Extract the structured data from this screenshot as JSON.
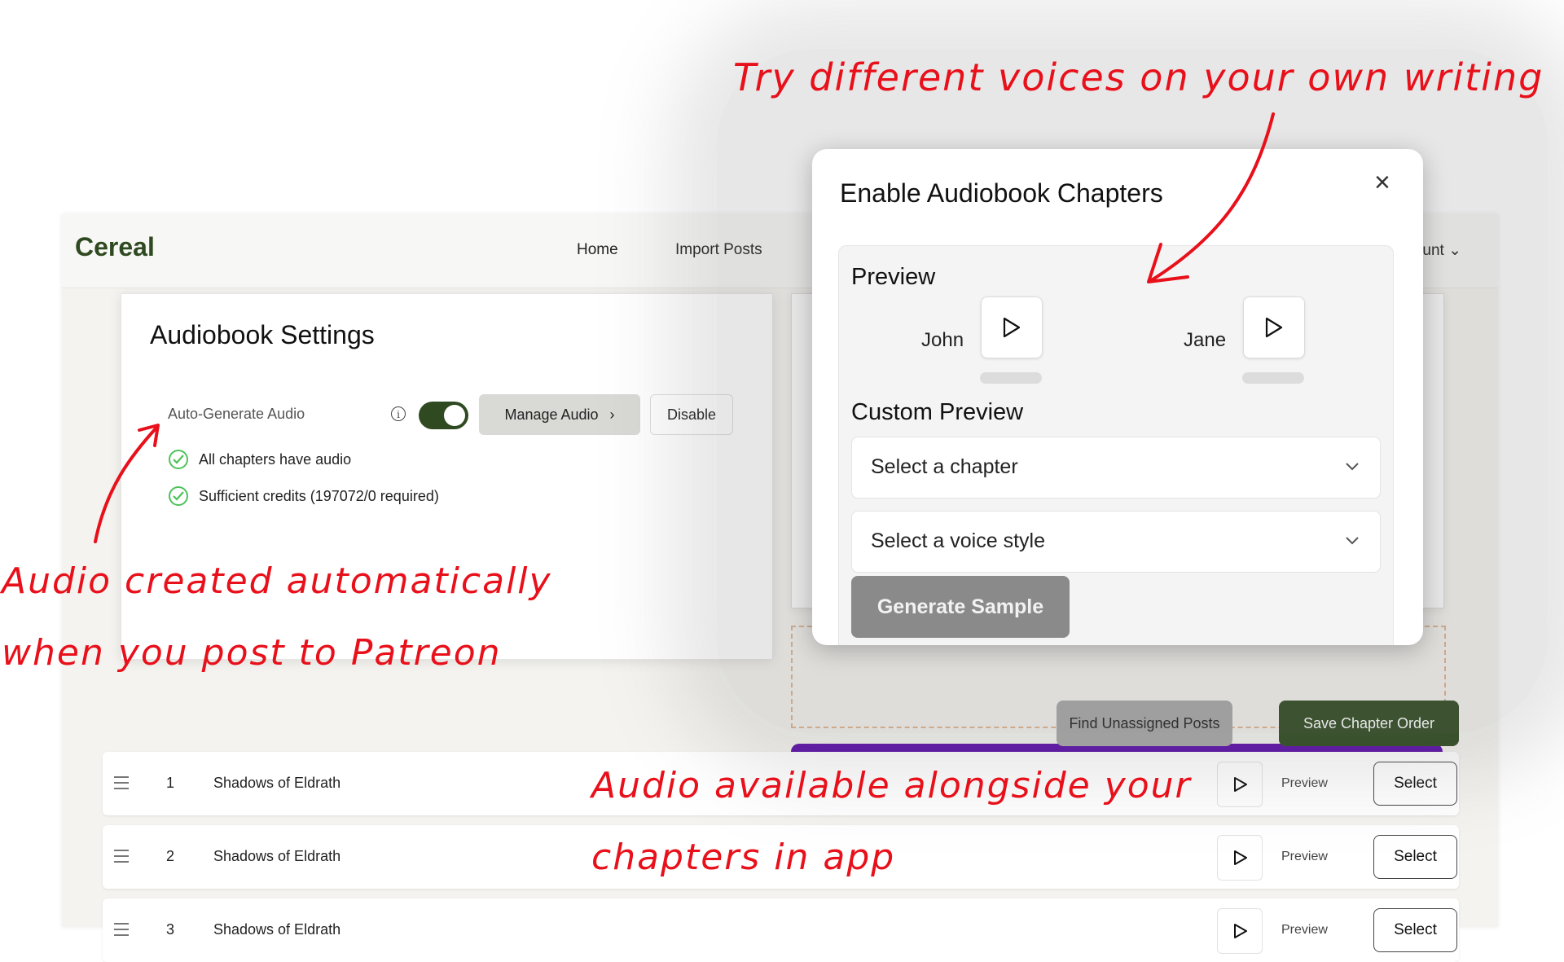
{
  "app": {
    "logo": "Cereal",
    "nav": [
      {
        "label": "Home"
      },
      {
        "label": "Import Posts"
      }
    ],
    "account_label": "unt"
  },
  "settings_card": {
    "title": "Audiobook Settings",
    "auto_generate_label": "Auto-Generate Audio",
    "auto_generate_on": true,
    "manage_audio_label": "Manage Audio",
    "disable_label": "Disable",
    "checks": [
      {
        "text": "All chapters have audio"
      },
      {
        "text": "Sufficient credits (197072/0 required)"
      }
    ]
  },
  "actions": {
    "find_unassigned_label": "Find Unassigned Posts",
    "save_order_label": "Save Chapter Order"
  },
  "chapters": [
    {
      "number": "1",
      "title": "Shadows of Eldrath",
      "preview_label": "Preview",
      "select_label": "Select"
    },
    {
      "number": "2",
      "title": "Shadows of Eldrath",
      "preview_label": "Preview",
      "select_label": "Select"
    },
    {
      "number": "3",
      "title": "Shadows of Eldrath",
      "preview_label": "Preview",
      "select_label": "Select"
    }
  ],
  "modal": {
    "title": "Enable Audiobook Chapters",
    "close_icon": "close-icon",
    "preview_heading": "Preview",
    "voices": [
      {
        "name": "John"
      },
      {
        "name": "Jane"
      }
    ],
    "custom_heading": "Custom Preview",
    "chapter_select_value": "Select a chapter",
    "voice_select_value": "Select a voice style",
    "generate_label": "Generate Sample"
  },
  "annotations": {
    "top": "Try different voices on your own writing",
    "left_line1": "Audio created automatically",
    "left_line2": "when you post to Patreon",
    "bottom_line1": "Audio available alongside your",
    "bottom_line2": "chapters in app"
  },
  "colors": {
    "brand": "#2f4a21",
    "annotation": "#e8101a",
    "accent_purple": "#5b0fa8",
    "success": "#4cc25a"
  }
}
